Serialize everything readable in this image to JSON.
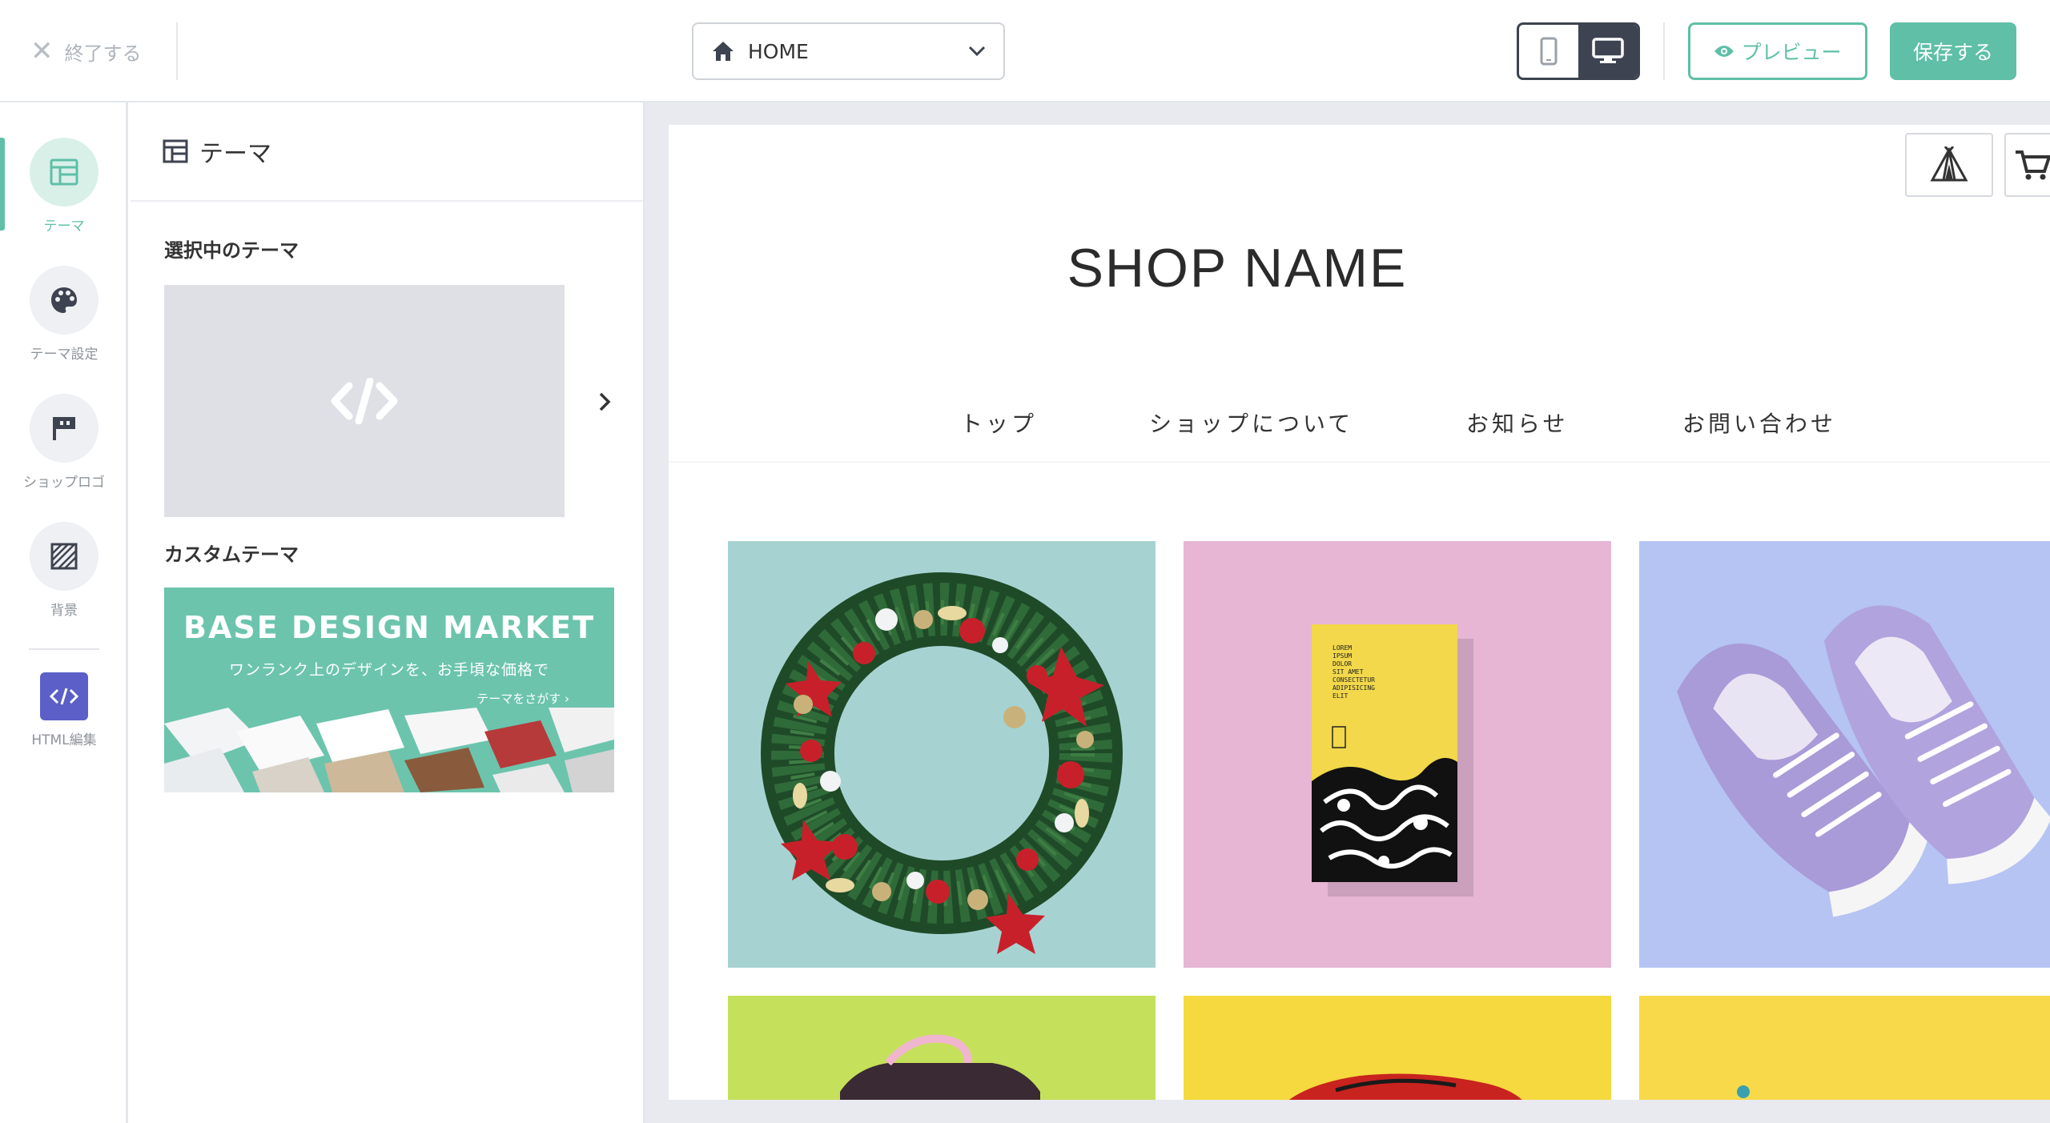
{
  "topbar": {
    "quit_label": "終了する",
    "page_select_value": "HOME",
    "preview_label": "プレビュー",
    "save_label": "保存する"
  },
  "rail": {
    "items": [
      {
        "label": "テーマ",
        "icon": "layout-icon",
        "active": true
      },
      {
        "label": "テーマ設定",
        "icon": "palette-icon"
      },
      {
        "label": "ショップロゴ",
        "icon": "flag-icon"
      },
      {
        "label": "背景",
        "icon": "hatch-pattern-icon"
      },
      {
        "label": "HTML編集",
        "icon": "code-icon"
      }
    ]
  },
  "panel": {
    "title": "テーマ",
    "selected_label": "選択中のテーマ",
    "custom_label": "カスタムテーマ",
    "banner": {
      "title": "BASE DESIGN MARKET",
      "subtitle": "ワンランク上のデザインを、お手頃な価格で",
      "link": "テーマをさがす"
    }
  },
  "preview": {
    "shop_name": "SHOP NAME",
    "nav": [
      "トップ",
      "ショップについて",
      "お知らせ",
      "お問い合わせ"
    ],
    "book_text": "LOREM IPSUM DOLOR SIT AMET CONSECTETUR ADIPISICING ELIT",
    "products": [
      {
        "name": "wreath",
        "bg": "#a6d3d2"
      },
      {
        "name": "book",
        "bg": "#e6b6d4"
      },
      {
        "name": "sneakers",
        "bg": "#b5c4f2"
      },
      {
        "name": "pink-item",
        "bg": "#c5e05a"
      },
      {
        "name": "red-item",
        "bg": "#f5d93e"
      },
      {
        "name": "yellow-item",
        "bg": "#f7d94a"
      }
    ]
  },
  "colors": {
    "accent": "#5fbfa7",
    "dark": "#3d4350",
    "html_edit": "#5b5fc7",
    "canvas_bg": "#e8eaef"
  }
}
